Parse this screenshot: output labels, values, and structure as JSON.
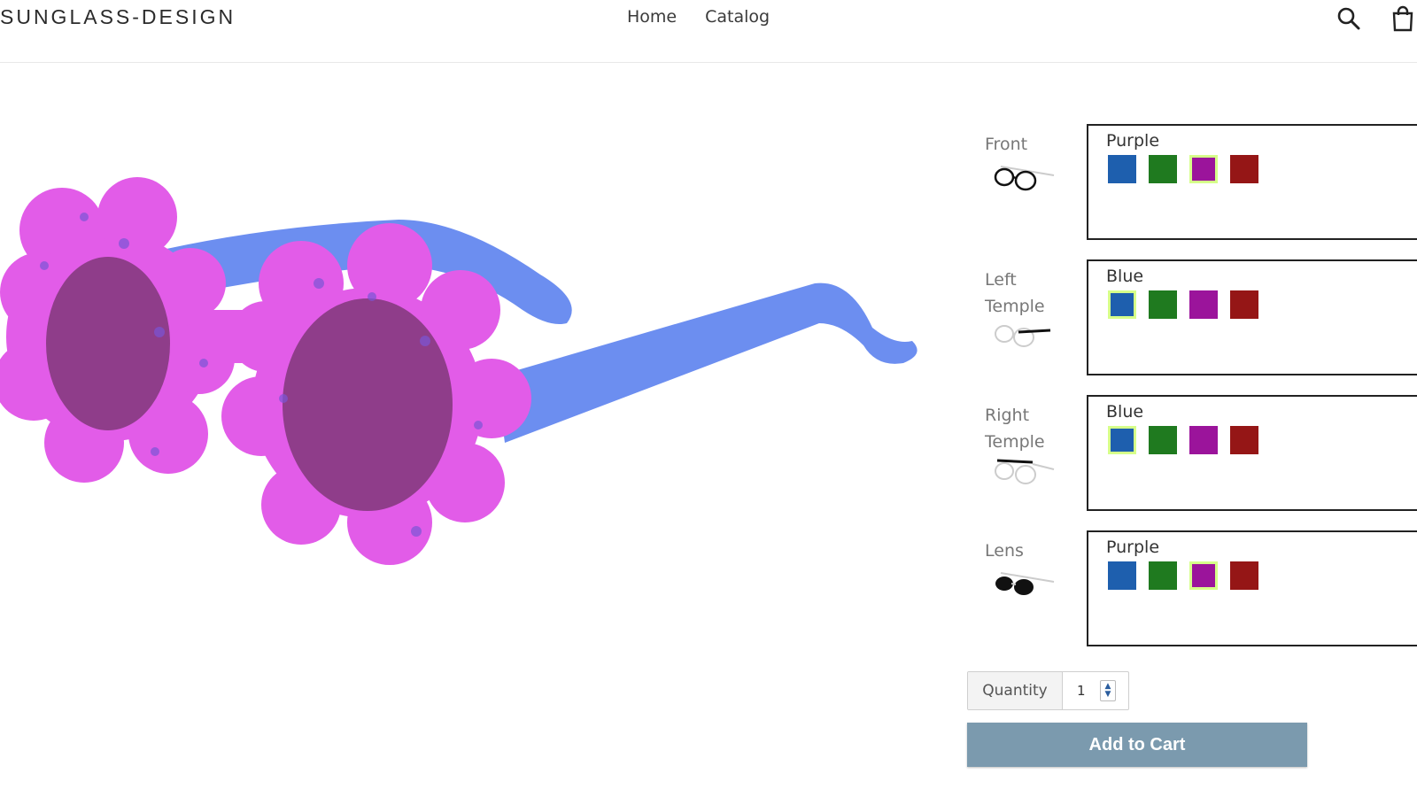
{
  "header": {
    "logo": "SUNGLASS-DESIGN",
    "nav": [
      {
        "label": "Home"
      },
      {
        "label": "Catalog"
      }
    ],
    "icons": [
      "search-icon",
      "cart-icon"
    ]
  },
  "product": {
    "colors": {
      "frame": "#e25ce8",
      "temples": "#6c8ef0",
      "lens": "#8f3d8a"
    }
  },
  "options": [
    {
      "label": "Front",
      "selected": "Purple",
      "thumb": "front-icon"
    },
    {
      "label": "Left Temple",
      "selected": "Blue",
      "thumb": "left-temple-icon"
    },
    {
      "label": "Right Temple",
      "selected": "Blue",
      "thumb": "right-temple-icon"
    },
    {
      "label": "Lens",
      "selected": "Purple",
      "thumb": "lens-icon"
    }
  ],
  "swatch_colors": [
    {
      "name": "blue",
      "hex": "#1e5fae"
    },
    {
      "name": "green",
      "hex": "#1f7a1f"
    },
    {
      "name": "purple",
      "hex": "#9b149b"
    },
    {
      "name": "red",
      "hex": "#951616"
    }
  ],
  "cart": {
    "quantity_label": "Quantity",
    "quantity_value": "1",
    "add_label": "Add to Cart"
  }
}
